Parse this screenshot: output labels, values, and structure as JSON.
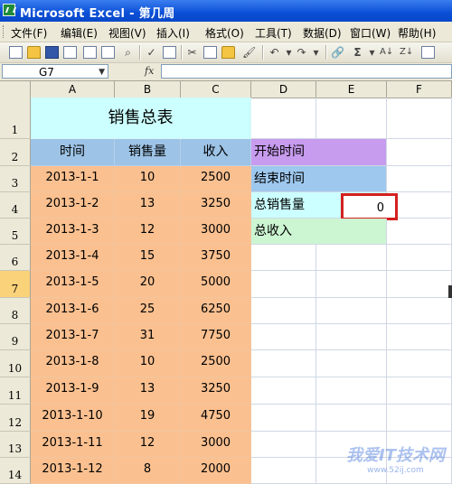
{
  "window": {
    "title": "Microsoft Excel - 第几周"
  },
  "menu": [
    "文件(F)",
    "编辑(E)",
    "视图(V)",
    "插入(I)",
    "格式(O)",
    "工具(T)",
    "数据(D)",
    "窗口(W)",
    "帮助(H)"
  ],
  "toolbar": {
    "sigma": "Σ",
    "sort": "A↓",
    "undo": "↶",
    "redo": "↷"
  },
  "formula_bar": {
    "name_box": "G7",
    "fx": "fx",
    "content": ""
  },
  "columns": [
    "A",
    "B",
    "C",
    "D",
    "E",
    "F"
  ],
  "rows": [
    "1",
    "2",
    "3",
    "4",
    "5",
    "6",
    "7",
    "8",
    "9",
    "10",
    "11",
    "12",
    "13",
    "14"
  ],
  "sheet": {
    "title": "销售总表",
    "headers": [
      "时间",
      "销售量",
      "收入"
    ],
    "data": [
      [
        "2013-1-1",
        "10",
        "2500"
      ],
      [
        "2013-1-2",
        "13",
        "3250"
      ],
      [
        "2013-1-3",
        "12",
        "3000"
      ],
      [
        "2013-1-4",
        "15",
        "3750"
      ],
      [
        "2013-1-5",
        "20",
        "5000"
      ],
      [
        "2013-1-6",
        "25",
        "6250"
      ],
      [
        "2013-1-7",
        "31",
        "7750"
      ],
      [
        "2013-1-8",
        "10",
        "2500"
      ],
      [
        "2013-1-9",
        "13",
        "3250"
      ],
      [
        "2013-1-10",
        "19",
        "4750"
      ],
      [
        "2013-1-11",
        "12",
        "3000"
      ],
      [
        "2013-1-12",
        "8",
        "2000"
      ]
    ],
    "side_labels": [
      "开始时间",
      "结束时间",
      "总销售量",
      "总收入"
    ],
    "total_sales_value": "0"
  },
  "watermark": {
    "line1": "我爱IT技术网",
    "line2": "www.52ij.com"
  },
  "colors": {
    "data_fill": "#fac090",
    "header_fill": "#9dc3e6",
    "title_fill": "#ccffff",
    "highlight": "#d42020"
  }
}
